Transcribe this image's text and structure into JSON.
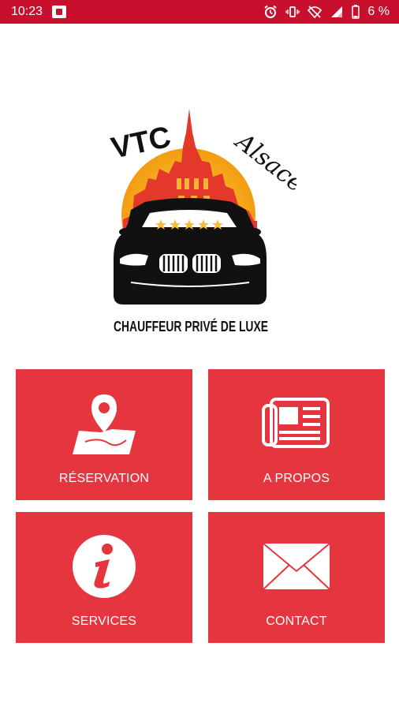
{
  "status_bar": {
    "time": "10:23",
    "battery": "6 %"
  },
  "logo": {
    "brand": "VTC",
    "region": "Alsace",
    "tagline": "CHAUFFEUR PRIVÉ DE LUXE"
  },
  "tiles": [
    {
      "label": "RÉSERVATION",
      "icon": "map-pin-icon"
    },
    {
      "label": "A PROPOS",
      "icon": "newspaper-icon"
    },
    {
      "label": "SERVICES",
      "icon": "info-icon"
    },
    {
      "label": "CONTACT",
      "icon": "envelope-icon"
    }
  ],
  "colors": {
    "status_bar": "#c8102e",
    "tile": "#e5363f",
    "text": "#ffffff"
  }
}
